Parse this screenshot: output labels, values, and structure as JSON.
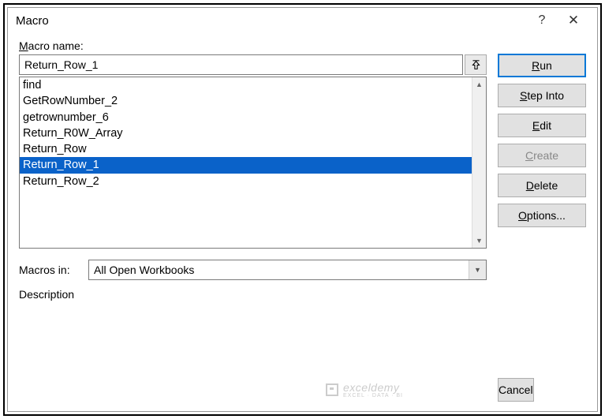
{
  "titlebar": {
    "title": "Macro",
    "help": "?",
    "close": "✕"
  },
  "labels": {
    "macro_name_prefix": "M",
    "macro_name_rest": "acro name:",
    "macros_in_prefix": "Macros ",
    "macros_in_underline": "i",
    "macros_in_rest": "n:",
    "description": "Description"
  },
  "macro_name_value": "Return_Row_1",
  "macro_list": [
    {
      "label": "find",
      "selected": false
    },
    {
      "label": "GetRowNumber_2",
      "selected": false
    },
    {
      "label": "getrownumber_6",
      "selected": false
    },
    {
      "label": "Return_R0W_Array",
      "selected": false
    },
    {
      "label": "Return_Row",
      "selected": false
    },
    {
      "label": "Return_Row_1",
      "selected": true
    },
    {
      "label": "Return_Row_2",
      "selected": false
    }
  ],
  "macros_in_value": "All Open Workbooks",
  "buttons": {
    "run_u": "R",
    "run_rest": "un",
    "step_u": "S",
    "step_rest": "tep Into",
    "edit_u": "E",
    "edit_rest": "dit",
    "create_u": "C",
    "create_rest": "reate",
    "delete_u": "D",
    "delete_rest": "elete",
    "options_u": "O",
    "options_rest": "ptions...",
    "cancel": "Cancel"
  },
  "watermark": {
    "main": "exceldemy",
    "sub": "EXCEL · DATA · BI"
  }
}
